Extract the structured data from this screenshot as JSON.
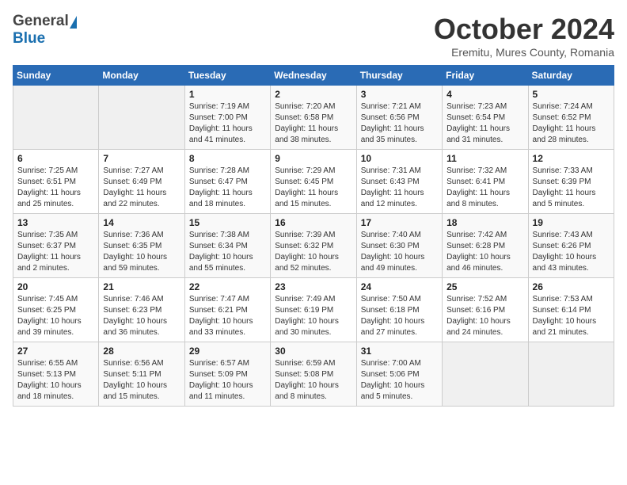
{
  "header": {
    "logo_general": "General",
    "logo_blue": "Blue",
    "month_title": "October 2024",
    "subtitle": "Eremitu, Mures County, Romania"
  },
  "weekdays": [
    "Sunday",
    "Monday",
    "Tuesday",
    "Wednesday",
    "Thursday",
    "Friday",
    "Saturday"
  ],
  "weeks": [
    [
      {
        "day": "",
        "sunrise": "",
        "sunset": "",
        "daylight": ""
      },
      {
        "day": "",
        "sunrise": "",
        "sunset": "",
        "daylight": ""
      },
      {
        "day": "1",
        "sunrise": "Sunrise: 7:19 AM",
        "sunset": "Sunset: 7:00 PM",
        "daylight": "Daylight: 11 hours and 41 minutes."
      },
      {
        "day": "2",
        "sunrise": "Sunrise: 7:20 AM",
        "sunset": "Sunset: 6:58 PM",
        "daylight": "Daylight: 11 hours and 38 minutes."
      },
      {
        "day": "3",
        "sunrise": "Sunrise: 7:21 AM",
        "sunset": "Sunset: 6:56 PM",
        "daylight": "Daylight: 11 hours and 35 minutes."
      },
      {
        "day": "4",
        "sunrise": "Sunrise: 7:23 AM",
        "sunset": "Sunset: 6:54 PM",
        "daylight": "Daylight: 11 hours and 31 minutes."
      },
      {
        "day": "5",
        "sunrise": "Sunrise: 7:24 AM",
        "sunset": "Sunset: 6:52 PM",
        "daylight": "Daylight: 11 hours and 28 minutes."
      }
    ],
    [
      {
        "day": "6",
        "sunrise": "Sunrise: 7:25 AM",
        "sunset": "Sunset: 6:51 PM",
        "daylight": "Daylight: 11 hours and 25 minutes."
      },
      {
        "day": "7",
        "sunrise": "Sunrise: 7:27 AM",
        "sunset": "Sunset: 6:49 PM",
        "daylight": "Daylight: 11 hours and 22 minutes."
      },
      {
        "day": "8",
        "sunrise": "Sunrise: 7:28 AM",
        "sunset": "Sunset: 6:47 PM",
        "daylight": "Daylight: 11 hours and 18 minutes."
      },
      {
        "day": "9",
        "sunrise": "Sunrise: 7:29 AM",
        "sunset": "Sunset: 6:45 PM",
        "daylight": "Daylight: 11 hours and 15 minutes."
      },
      {
        "day": "10",
        "sunrise": "Sunrise: 7:31 AM",
        "sunset": "Sunset: 6:43 PM",
        "daylight": "Daylight: 11 hours and 12 minutes."
      },
      {
        "day": "11",
        "sunrise": "Sunrise: 7:32 AM",
        "sunset": "Sunset: 6:41 PM",
        "daylight": "Daylight: 11 hours and 8 minutes."
      },
      {
        "day": "12",
        "sunrise": "Sunrise: 7:33 AM",
        "sunset": "Sunset: 6:39 PM",
        "daylight": "Daylight: 11 hours and 5 minutes."
      }
    ],
    [
      {
        "day": "13",
        "sunrise": "Sunrise: 7:35 AM",
        "sunset": "Sunset: 6:37 PM",
        "daylight": "Daylight: 11 hours and 2 minutes."
      },
      {
        "day": "14",
        "sunrise": "Sunrise: 7:36 AM",
        "sunset": "Sunset: 6:35 PM",
        "daylight": "Daylight: 10 hours and 59 minutes."
      },
      {
        "day": "15",
        "sunrise": "Sunrise: 7:38 AM",
        "sunset": "Sunset: 6:34 PM",
        "daylight": "Daylight: 10 hours and 55 minutes."
      },
      {
        "day": "16",
        "sunrise": "Sunrise: 7:39 AM",
        "sunset": "Sunset: 6:32 PM",
        "daylight": "Daylight: 10 hours and 52 minutes."
      },
      {
        "day": "17",
        "sunrise": "Sunrise: 7:40 AM",
        "sunset": "Sunset: 6:30 PM",
        "daylight": "Daylight: 10 hours and 49 minutes."
      },
      {
        "day": "18",
        "sunrise": "Sunrise: 7:42 AM",
        "sunset": "Sunset: 6:28 PM",
        "daylight": "Daylight: 10 hours and 46 minutes."
      },
      {
        "day": "19",
        "sunrise": "Sunrise: 7:43 AM",
        "sunset": "Sunset: 6:26 PM",
        "daylight": "Daylight: 10 hours and 43 minutes."
      }
    ],
    [
      {
        "day": "20",
        "sunrise": "Sunrise: 7:45 AM",
        "sunset": "Sunset: 6:25 PM",
        "daylight": "Daylight: 10 hours and 39 minutes."
      },
      {
        "day": "21",
        "sunrise": "Sunrise: 7:46 AM",
        "sunset": "Sunset: 6:23 PM",
        "daylight": "Daylight: 10 hours and 36 minutes."
      },
      {
        "day": "22",
        "sunrise": "Sunrise: 7:47 AM",
        "sunset": "Sunset: 6:21 PM",
        "daylight": "Daylight: 10 hours and 33 minutes."
      },
      {
        "day": "23",
        "sunrise": "Sunrise: 7:49 AM",
        "sunset": "Sunset: 6:19 PM",
        "daylight": "Daylight: 10 hours and 30 minutes."
      },
      {
        "day": "24",
        "sunrise": "Sunrise: 7:50 AM",
        "sunset": "Sunset: 6:18 PM",
        "daylight": "Daylight: 10 hours and 27 minutes."
      },
      {
        "day": "25",
        "sunrise": "Sunrise: 7:52 AM",
        "sunset": "Sunset: 6:16 PM",
        "daylight": "Daylight: 10 hours and 24 minutes."
      },
      {
        "day": "26",
        "sunrise": "Sunrise: 7:53 AM",
        "sunset": "Sunset: 6:14 PM",
        "daylight": "Daylight: 10 hours and 21 minutes."
      }
    ],
    [
      {
        "day": "27",
        "sunrise": "Sunrise: 6:55 AM",
        "sunset": "Sunset: 5:13 PM",
        "daylight": "Daylight: 10 hours and 18 minutes."
      },
      {
        "day": "28",
        "sunrise": "Sunrise: 6:56 AM",
        "sunset": "Sunset: 5:11 PM",
        "daylight": "Daylight: 10 hours and 15 minutes."
      },
      {
        "day": "29",
        "sunrise": "Sunrise: 6:57 AM",
        "sunset": "Sunset: 5:09 PM",
        "daylight": "Daylight: 10 hours and 11 minutes."
      },
      {
        "day": "30",
        "sunrise": "Sunrise: 6:59 AM",
        "sunset": "Sunset: 5:08 PM",
        "daylight": "Daylight: 10 hours and 8 minutes."
      },
      {
        "day": "31",
        "sunrise": "Sunrise: 7:00 AM",
        "sunset": "Sunset: 5:06 PM",
        "daylight": "Daylight: 10 hours and 5 minutes."
      },
      {
        "day": "",
        "sunrise": "",
        "sunset": "",
        "daylight": ""
      },
      {
        "day": "",
        "sunrise": "",
        "sunset": "",
        "daylight": ""
      }
    ]
  ]
}
